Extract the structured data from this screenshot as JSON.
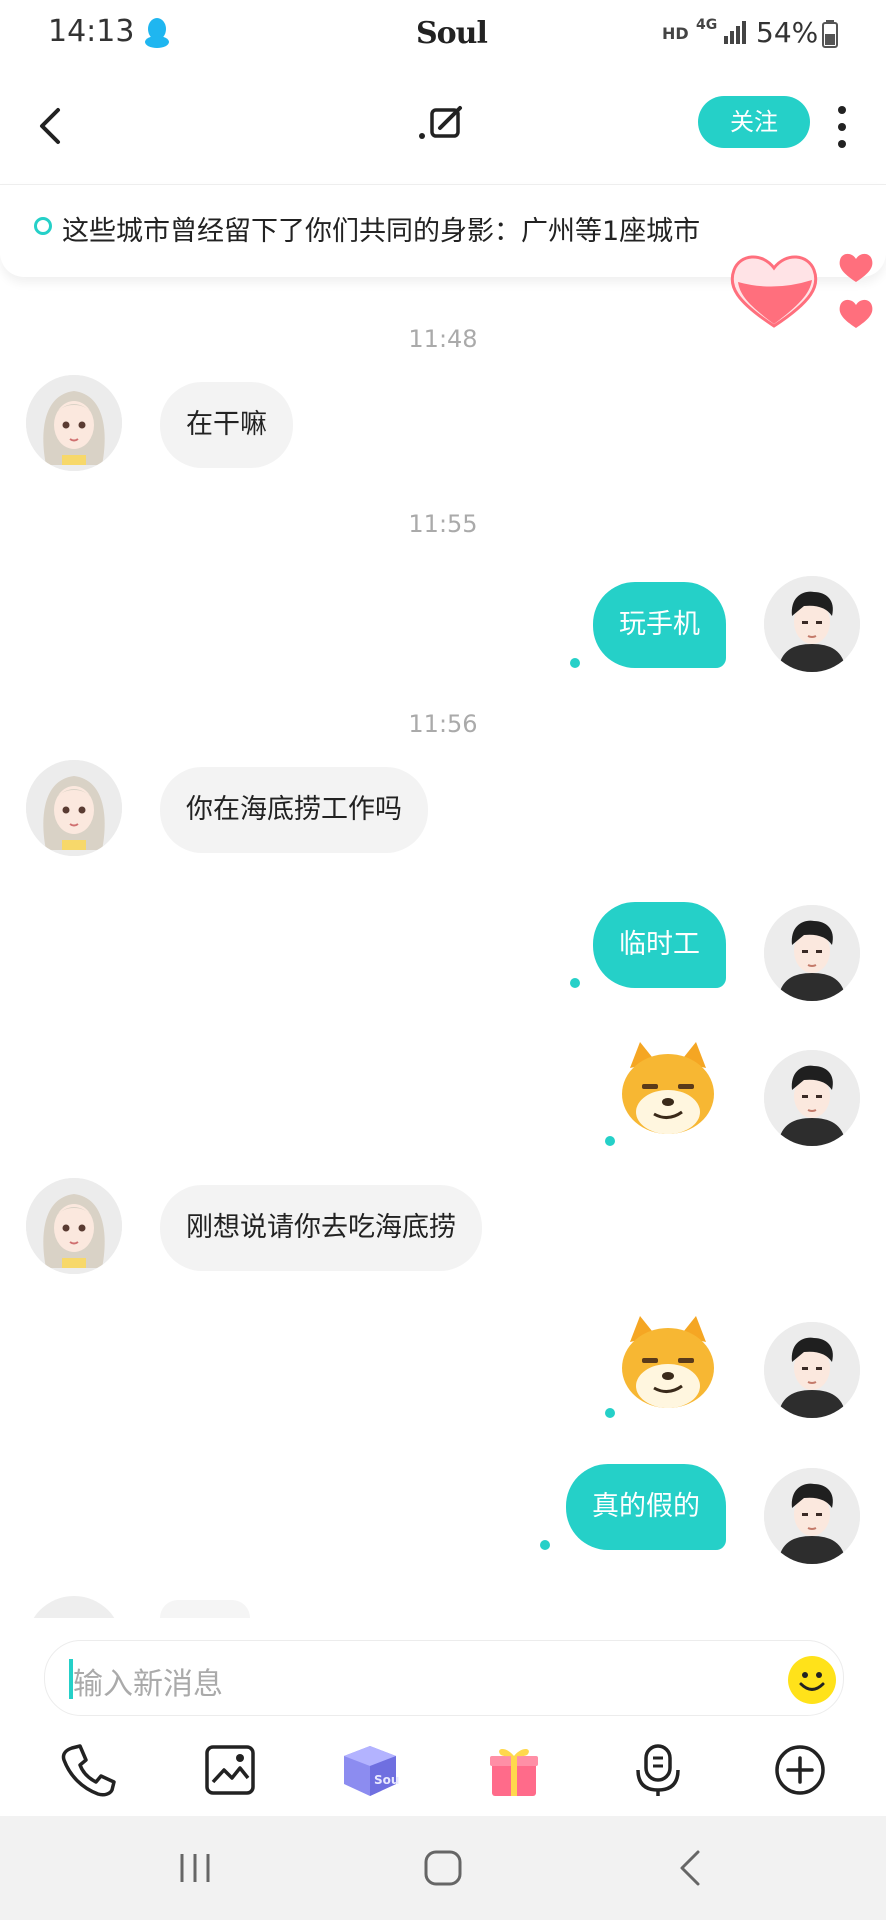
{
  "status_bar": {
    "time": "14:13",
    "app_name": "Soul",
    "hd": "HD",
    "network": "4G",
    "battery": "54%"
  },
  "header": {
    "follow_label": "关注"
  },
  "banner": {
    "text": "这些城市曾经留下了你们共同的身影：广州等1座城市"
  },
  "messages": [
    {
      "type": "time",
      "text": "11:48"
    },
    {
      "type": "text",
      "side": "left",
      "text": "在干嘛"
    },
    {
      "type": "time",
      "text": "11:55"
    },
    {
      "type": "text",
      "side": "right",
      "text": "玩手机"
    },
    {
      "type": "time",
      "text": "11:56"
    },
    {
      "type": "text",
      "side": "left",
      "text": "你在海底捞工作吗"
    },
    {
      "type": "text",
      "side": "right",
      "text": "临时工"
    },
    {
      "type": "sticker",
      "side": "right",
      "sticker": "shiba-smirk"
    },
    {
      "type": "text",
      "side": "left",
      "text": "刚想说请你去吃海底捞"
    },
    {
      "type": "sticker",
      "side": "right",
      "sticker": "shiba-smirk"
    },
    {
      "type": "text",
      "side": "right",
      "text": "真的假的"
    }
  ],
  "input": {
    "placeholder": "输入新消息"
  },
  "colors": {
    "accent": "#25d0c8",
    "bubble_left": "#f3f3f3"
  },
  "toolbar_icons": [
    "phone-icon",
    "image-icon",
    "soul-box-icon",
    "gift-icon",
    "voice-icon",
    "plus-icon"
  ]
}
